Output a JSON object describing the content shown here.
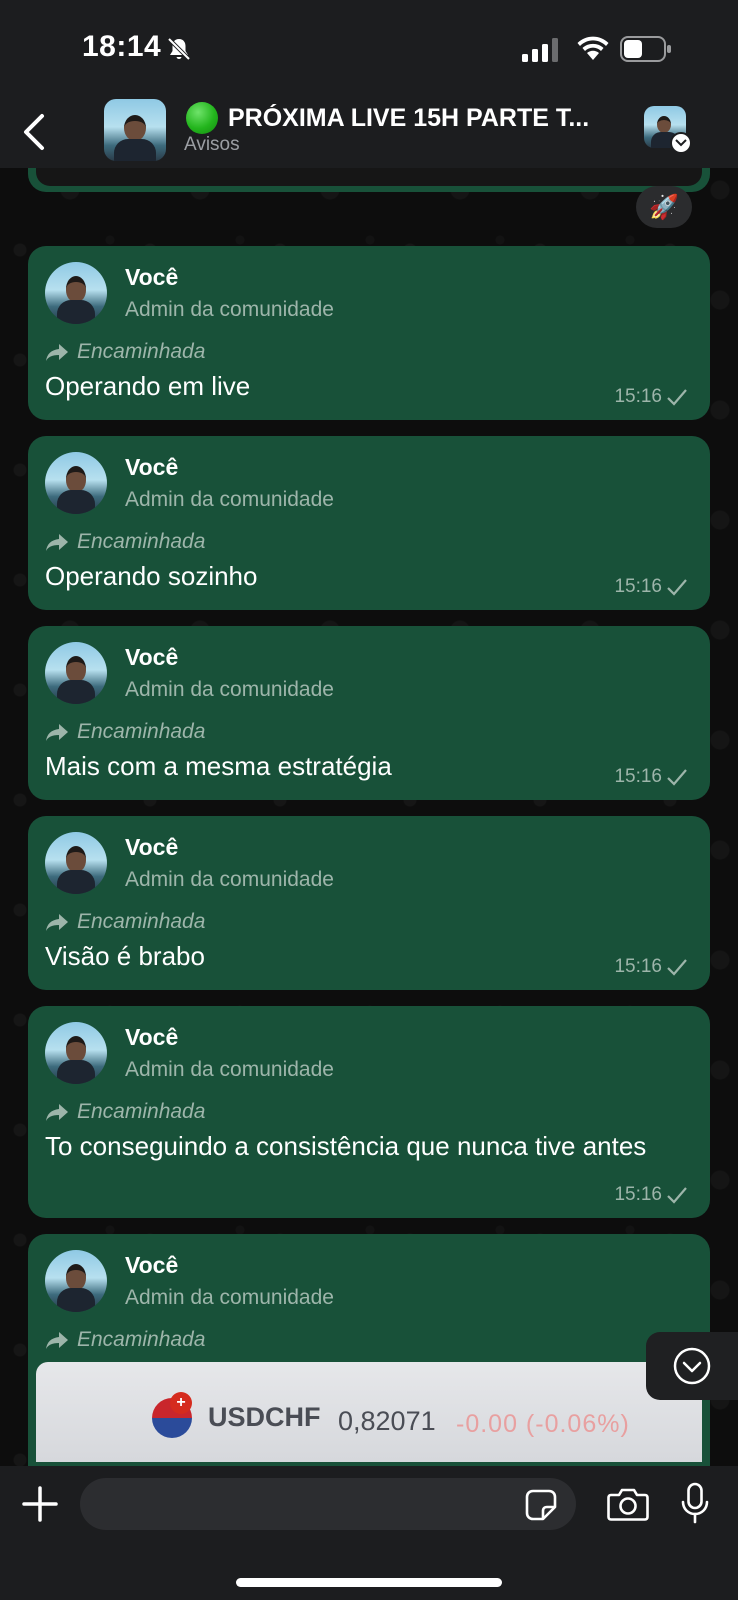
{
  "status_bar": {
    "time": "18:14"
  },
  "header": {
    "title": "PRÓXIMA LIVE 15H PARTE T...",
    "subtitle": "Avisos",
    "status_dot_color": "#22b31b"
  },
  "previous_message": {
    "reaction": "🚀"
  },
  "messages": [
    {
      "sender": "Você",
      "role": "Admin da comunidade",
      "forwarded_label": "Encaminhada",
      "text": "Operando em live",
      "time": "15:16"
    },
    {
      "sender": "Você",
      "role": "Admin da comunidade",
      "forwarded_label": "Encaminhada",
      "text": "Operando sozinho",
      "time": "15:16"
    },
    {
      "sender": "Você",
      "role": "Admin da comunidade",
      "forwarded_label": "Encaminhada",
      "text": "Mais com a mesma estratégia",
      "time": "15:16"
    },
    {
      "sender": "Você",
      "role": "Admin da comunidade",
      "forwarded_label": "Encaminhada",
      "text": "Visão é brabo",
      "time": "15:16"
    },
    {
      "sender": "Você",
      "role": "Admin da comunidade",
      "forwarded_label": "Encaminhada",
      "text": "To conseguindo a consistência que nunca tive antes",
      "time": "15:16"
    },
    {
      "sender": "Você",
      "role": "Admin da comunidade",
      "forwarded_label": "Encaminhada",
      "media": {
        "ticker": "USDCHF",
        "price": "0,82071",
        "change": "-0.00 (-0.06%)"
      }
    }
  ],
  "input": {
    "placeholder": ""
  },
  "colors": {
    "bubble": "#185139",
    "bar": "#1c1d1f",
    "meta_text": "#9db5aa"
  },
  "icons": [
    "bell-off-icon",
    "signal-icon",
    "wifi-icon",
    "battery-icon",
    "back-chevron-icon",
    "forward-arrow-icon",
    "check-icon",
    "chevron-down-circle-icon",
    "plus-icon",
    "sticker-icon",
    "camera-icon",
    "microphone-icon"
  ]
}
